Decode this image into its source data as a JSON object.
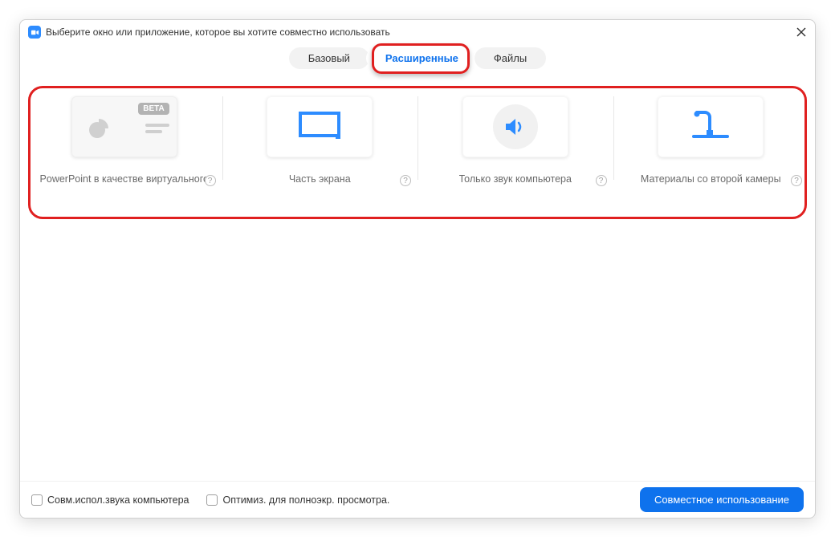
{
  "window": {
    "title": "Выберите окно или приложение, которое вы хотите совместно использовать"
  },
  "tabs": {
    "basic": "Базовый",
    "advanced": "Расширенные",
    "files": "Файлы"
  },
  "options": {
    "powerpoint": {
      "label": "PowerPoint в качестве виртуального",
      "badge": "BETA"
    },
    "portion": {
      "label": "Часть экрана"
    },
    "audio": {
      "label": "Только звук компьютера"
    },
    "second_cam": {
      "label": "Материалы со второй камеры"
    }
  },
  "help_glyph": "?",
  "footer": {
    "share_audio": "Совм.испол.звука компьютера",
    "optimize_video": "Оптимиз. для полноэкр. просмотра.",
    "share_button": "Совместное использование"
  }
}
